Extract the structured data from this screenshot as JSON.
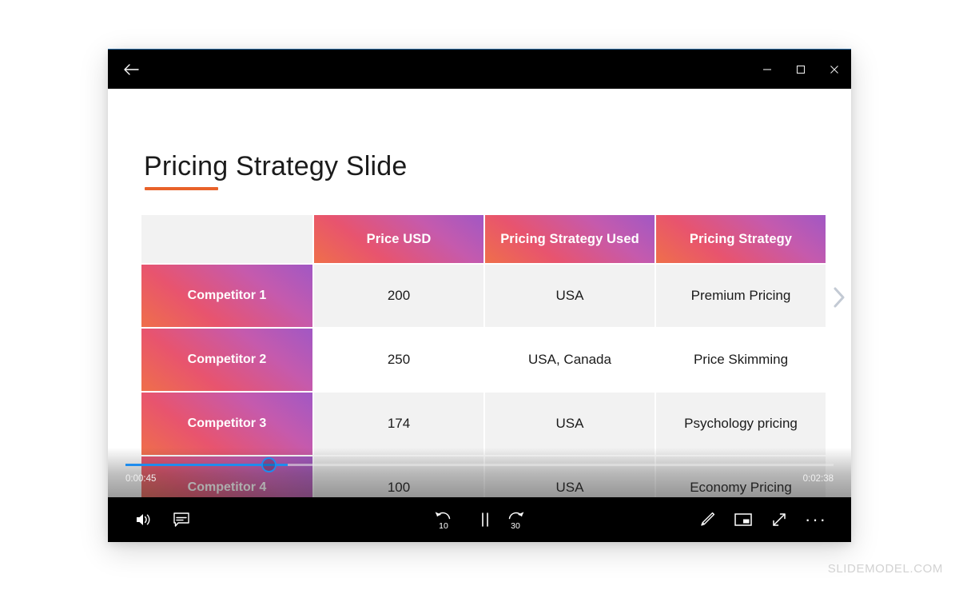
{
  "window": {
    "back_icon": "arrow-left-icon",
    "minimize_label": "–",
    "maximize_label": "□",
    "close_label": "✕"
  },
  "slide": {
    "title": "Pricing Strategy Slide",
    "accent_color": "#e8622a",
    "next_slide_icon": "chevron-right-icon",
    "table": {
      "corner_label": "",
      "headers": [
        "Price USD",
        "Pricing Strategy Used",
        "Pricing Strategy"
      ],
      "rows": [
        {
          "name": "Competitor 1",
          "price": "200",
          "market": "USA",
          "strategy": "Premium Pricing"
        },
        {
          "name": "Competitor 2",
          "price": "250",
          "market": "USA, Canada",
          "strategy": "Price Skimming"
        },
        {
          "name": "Competitor 3",
          "price": "174",
          "market": "USA",
          "strategy": "Psychology pricing"
        },
        {
          "name": "Competitor 4",
          "price": "100",
          "market": "USA",
          "strategy": "Economy Pricing"
        }
      ],
      "header_gradient_from": "#ef6f4a",
      "header_gradient_to": "#a158c4"
    }
  },
  "player": {
    "current_time": "0:00:45",
    "total_time": "0:02:38",
    "progress_color": "#1f8ced",
    "volume_icon": "volume-icon",
    "captions_icon": "captions-icon",
    "rewind_label": "10",
    "rewind_icon": "rewind-10-icon",
    "play_pause_icon": "pause-icon",
    "forward_label": "30",
    "forward_icon": "forward-30-icon",
    "draw_icon": "pencil-icon",
    "miniplayer_icon": "mini-player-icon",
    "fullscreen_icon": "fullscreen-icon",
    "more_icon": "more-options-icon",
    "more_label": "···"
  },
  "watermark": {
    "text": "SLIDEMODEL.COM"
  }
}
